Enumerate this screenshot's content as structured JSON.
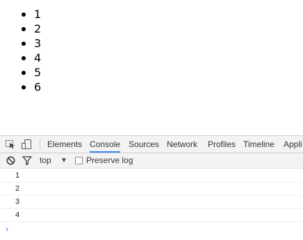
{
  "page": {
    "list_items": [
      "1",
      "2",
      "3",
      "4",
      "5",
      "6"
    ]
  },
  "devtools": {
    "tabs": [
      {
        "label": "Elements",
        "active": false
      },
      {
        "label": "Console",
        "active": true
      },
      {
        "label": "Sources",
        "active": false
      },
      {
        "label": "Network",
        "active": false
      },
      {
        "label": "Profiles",
        "active": false
      },
      {
        "label": "Timeline",
        "active": false
      },
      {
        "label": "Appli",
        "active": false
      }
    ],
    "toolbar": {
      "context": "top",
      "context_arrow": "▼",
      "preserve_log_label": "Preserve log",
      "preserve_log_checked": false
    },
    "console_lines": [
      "1",
      "2",
      "3",
      "4"
    ],
    "prompt": "›",
    "colors": {
      "accent": "#4285f4",
      "panel_bg": "#f3f3f3",
      "prompt": "#2a7bde"
    },
    "icons": [
      "inspect-element-icon",
      "device-mode-icon",
      "clear-console-icon",
      "filter-icon"
    ]
  }
}
